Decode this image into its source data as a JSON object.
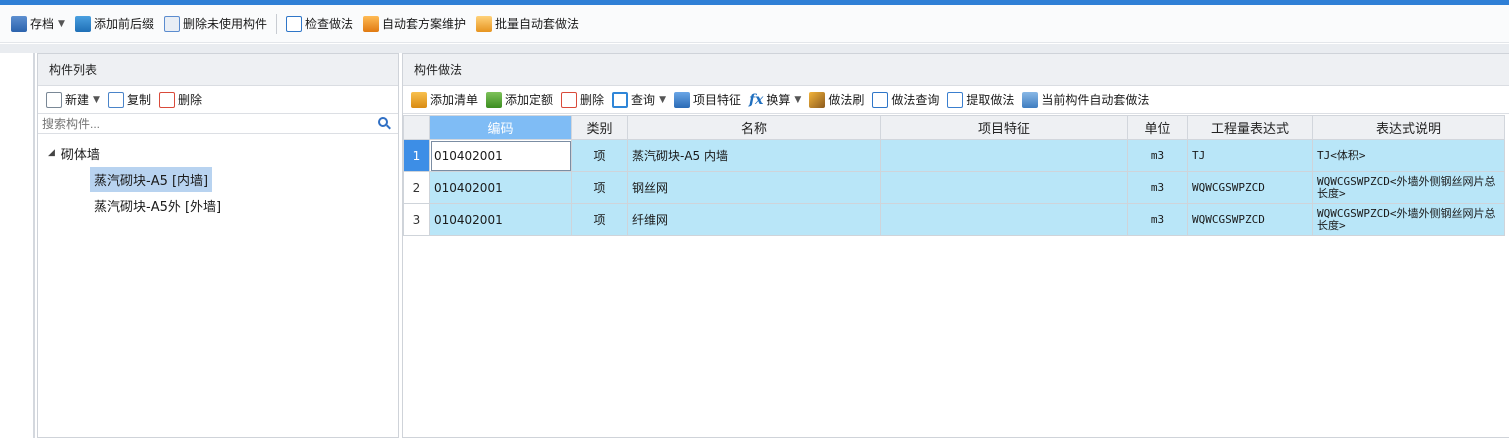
{
  "toolbar": {
    "save": "存档",
    "add_prefix": "添加前后缀",
    "delete_unused": "删除未使用构件",
    "check_method": "检查做法",
    "auto_scheme": "自动套方案维护",
    "batch_auto": "批量自动套做法"
  },
  "left_panel": {
    "title": "构件列表",
    "new": "新建",
    "copy": "复制",
    "delete": "删除",
    "search_placeholder": "搜索构件...",
    "tree": {
      "root": "砌体墙",
      "children": [
        "蒸汽砌块-A5 [内墙]",
        "蒸汽砌块-A5外 [外墙]"
      ]
    }
  },
  "right_panel": {
    "title": "构件做法",
    "toolbar": {
      "add_list": "添加清单",
      "add_quota": "添加定额",
      "delete": "删除",
      "query": "查询",
      "item_feature": "项目特征",
      "fx": "fx",
      "convert": "换算",
      "method_brush": "做法刷",
      "method_query": "做法查询",
      "extract": "提取做法",
      "current_auto": "当前构件自动套做法"
    },
    "columns": [
      "编码",
      "类别",
      "名称",
      "项目特征",
      "单位",
      "工程量表达式",
      "表达式说明"
    ],
    "rows": [
      {
        "no": "1",
        "code": "010402001",
        "type": "项",
        "name": "蒸汽砌块-A5 内墙",
        "feature": "",
        "unit": "m3",
        "expr": "TJ",
        "desc": "TJ<体积>"
      },
      {
        "no": "2",
        "code": "010402001",
        "type": "项",
        "name": "钢丝网",
        "feature": "",
        "unit": "m3",
        "expr": "WQWCGSWPZCD",
        "desc": "WQWCGSWPZCD<外墙外侧钢丝网片总长度>"
      },
      {
        "no": "3",
        "code": "010402001",
        "type": "项",
        "name": "纤维网",
        "feature": "",
        "unit": "m3",
        "expr": "WQWCGSWPZCD",
        "desc": "WQWCGSWPZCD<外墙外侧钢丝网片总长度>"
      }
    ]
  },
  "colors": {
    "accent": "#2f7fd6",
    "row_fill": "#b9e6f8",
    "sorted_header": "#7fbcf5",
    "selected_tree": "#b8d3f0"
  }
}
